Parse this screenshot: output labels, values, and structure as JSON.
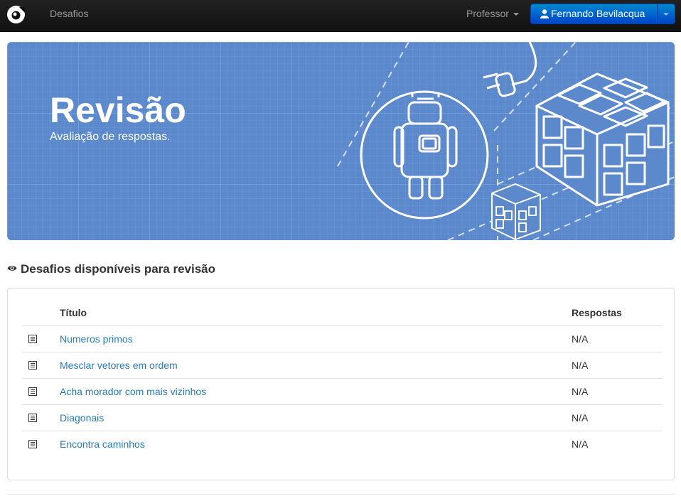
{
  "navbar": {
    "brand_icon": "logo-icon",
    "desafios_label": "Desafios",
    "professor_label": "Professor",
    "user_name": "Fernando Bevilacqua",
    "user_icon": "user-icon"
  },
  "hero": {
    "title": "Revisão",
    "subtitle": "Avaliação de respostas."
  },
  "section": {
    "icon": "eye-icon",
    "heading": "Desafios disponíveis para revisão"
  },
  "table": {
    "columns": [
      "Título",
      "Respostas"
    ],
    "rows": [
      {
        "icon": "list-icon",
        "title": "Numeros primos",
        "respostas": "N/A"
      },
      {
        "icon": "list-icon",
        "title": "Mesclar vetores em ordem",
        "respostas": "N/A"
      },
      {
        "icon": "list-icon",
        "title": "Acha morador com mais vizinhos",
        "respostas": "N/A"
      },
      {
        "icon": "list-icon",
        "title": "Diagonais",
        "respostas": "N/A"
      },
      {
        "icon": "list-icon",
        "title": "Encontra caminhos",
        "respostas": "N/A"
      }
    ]
  },
  "colors": {
    "navbar_bg": "#1b1b1b",
    "hero_bg": "#5b89cc",
    "primary_button": "#0062cc",
    "link": "#2a7ab8"
  }
}
